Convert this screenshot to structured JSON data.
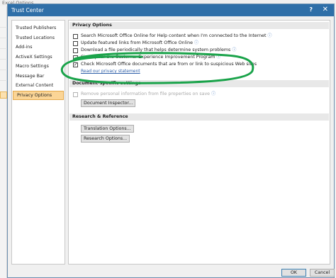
{
  "background_window": {
    "title": "Excel Options"
  },
  "dialog": {
    "title": "Trust Center",
    "help_glyph": "?",
    "close_glyph": "✕"
  },
  "nav": {
    "items": [
      {
        "label": "Trusted Publishers"
      },
      {
        "label": "Trusted Locations"
      },
      {
        "label": "Add-ins"
      },
      {
        "label": "ActiveX Settings"
      },
      {
        "label": "Macro Settings"
      },
      {
        "label": "Message Bar"
      },
      {
        "label": "External Content"
      },
      {
        "label": "Privacy Options"
      }
    ],
    "active": "Privacy Options"
  },
  "privacy": {
    "header": "Privacy Options",
    "options": [
      {
        "label": "Search Microsoft Office Online for Help content when I'm connected to the Internet",
        "checked": false
      },
      {
        "label": "Update featured links from Microsoft Office Online",
        "checked": false
      },
      {
        "label": "Download a file periodically that helps determine system problems",
        "checked": false
      },
      {
        "label": "Sign up for the Customer Experience Improvement Program",
        "checked": false
      },
      {
        "label": "Check Microsoft Office documents that are from or link to suspicious Web sites",
        "checked": true
      }
    ],
    "link": "Read our privacy statement"
  },
  "document_specific": {
    "header": "Document-specific settings",
    "option": {
      "label": "Remove personal information from file properties on save",
      "checked": false,
      "disabled": true
    },
    "button": "Document Inspector..."
  },
  "research": {
    "header": "Research & Reference",
    "buttons": [
      "Translation Options...",
      "Research Options..."
    ]
  },
  "footer": {
    "ok": "OK",
    "cancel": "Cancel"
  },
  "colors": {
    "titlebar": "#2f6fa8",
    "active_nav": "#fbd596",
    "annotation": "#1aa34a"
  }
}
